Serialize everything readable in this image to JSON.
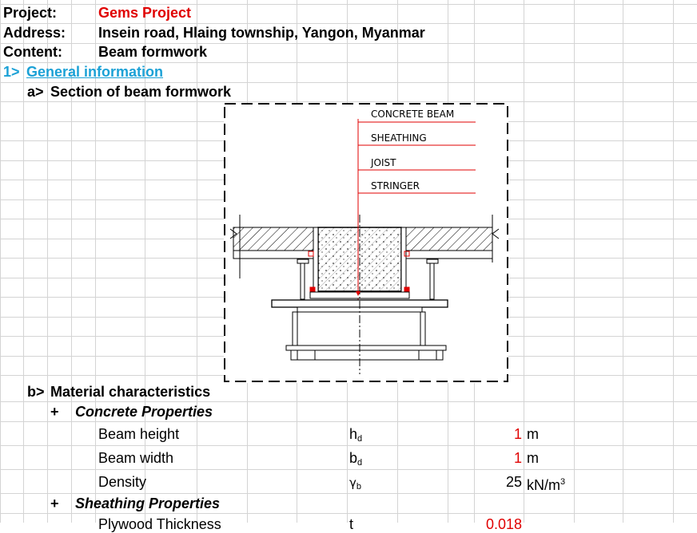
{
  "header": {
    "project_label": "Project:",
    "project_value": "Gems Project",
    "address_label": "Address:",
    "address_value": "Insein road, Hlaing township, Yangon, Myanmar",
    "content_label": "Content:",
    "content_value": "Beam formwork"
  },
  "section1": {
    "number": "1>",
    "title": "General information"
  },
  "sub_a": {
    "marker": "a>",
    "title": "Section of beam formwork"
  },
  "drawing": {
    "labels": [
      "CONCRETE BEAM",
      "SHEATHING",
      "JOIST",
      "STRINGER"
    ],
    "accent_color": "#e00000"
  },
  "sub_b": {
    "marker": "b>",
    "title": "Material characteristics"
  },
  "concrete": {
    "marker": "+",
    "title": "Concrete Properties",
    "rows": [
      {
        "name": "Beam height",
        "symbol": "h",
        "sub": "d",
        "value": "1",
        "unit": "m",
        "value_color": "red"
      },
      {
        "name": "Beam width",
        "symbol": "b",
        "sub": "d",
        "value": "1",
        "unit": "m",
        "value_color": "red"
      },
      {
        "name": "Density",
        "symbol": "γ",
        "sub": "b",
        "value": "25",
        "unit": "kN/m",
        "unit_sup": "3",
        "value_color": "black"
      }
    ]
  },
  "sheathing": {
    "marker": "+",
    "title": "Sheathing Properties",
    "partial_row": {
      "name": "Plywood Thickness",
      "symbol": "t",
      "value": "0.018"
    }
  }
}
